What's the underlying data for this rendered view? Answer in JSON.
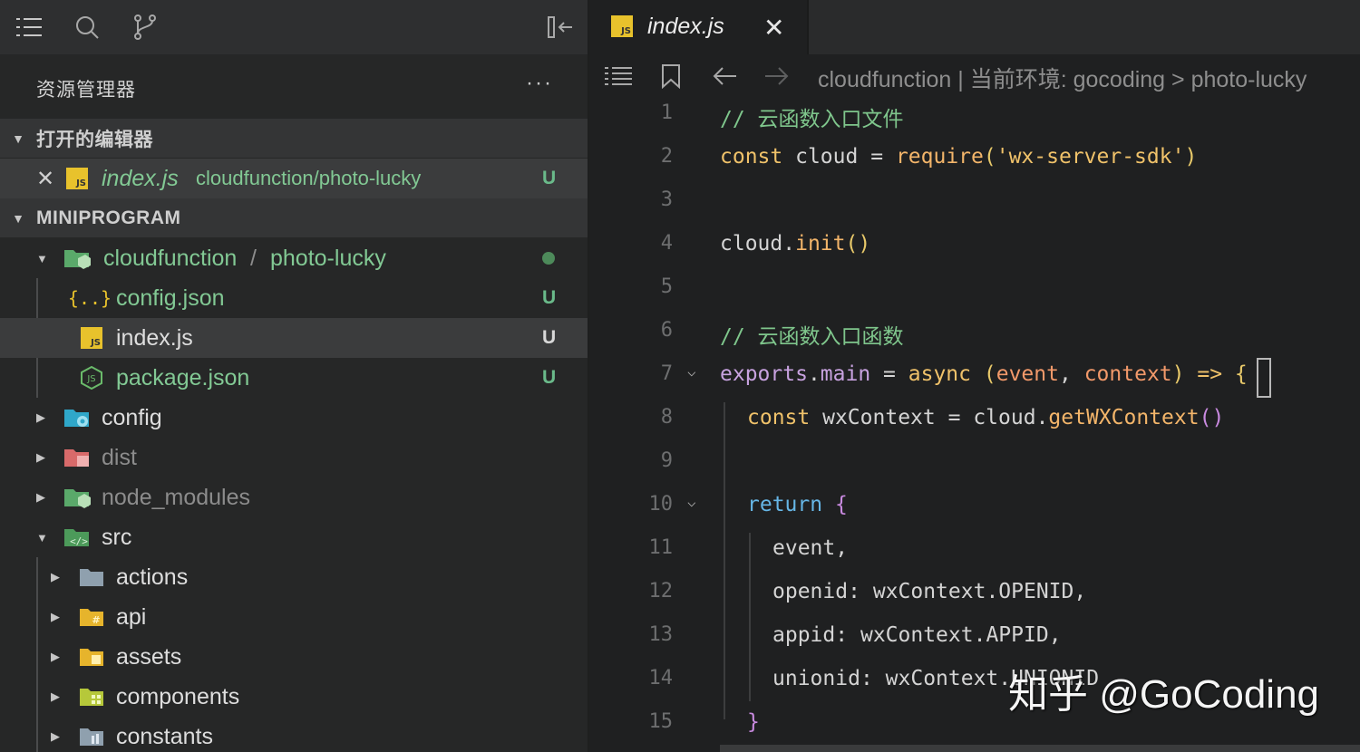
{
  "sidebar": {
    "title": "资源管理器",
    "more": "···",
    "open_editors": {
      "label": "打开的编辑器",
      "file": {
        "name": "index.js",
        "path": "cloudfunction/photo-lucky",
        "status": "U"
      }
    },
    "project": {
      "label": "MINIPROGRAM",
      "items": [
        {
          "name_a": "cloudfunction",
          "sep": " / ",
          "name_b": "photo-lucky"
        },
        {
          "name": "config.json",
          "status": "U"
        },
        {
          "name": "index.js",
          "status": "U"
        },
        {
          "name": "package.json",
          "status": "U"
        },
        {
          "name": "config"
        },
        {
          "name": "dist"
        },
        {
          "name": "node_modules"
        },
        {
          "name": "src"
        },
        {
          "name": "actions"
        },
        {
          "name": "api"
        },
        {
          "name": "assets"
        },
        {
          "name": "components"
        },
        {
          "name": "constants"
        }
      ]
    }
  },
  "editor": {
    "tab": {
      "label": "index.js",
      "close": "✕"
    },
    "breadcrumb": "cloudfunction | 当前环境: gocoding  >  photo-lucky",
    "line_numbers": [
      "1",
      "2",
      "3",
      "4",
      "5",
      "6",
      "7",
      "8",
      "9",
      "10",
      "11",
      "12",
      "13",
      "14",
      "15"
    ]
  },
  "watermark": "知乎 @GoCoding",
  "colors": {
    "accent_green": "#82c994",
    "js_yellow": "#e8c22c",
    "badge_green": "#6aba8a"
  }
}
